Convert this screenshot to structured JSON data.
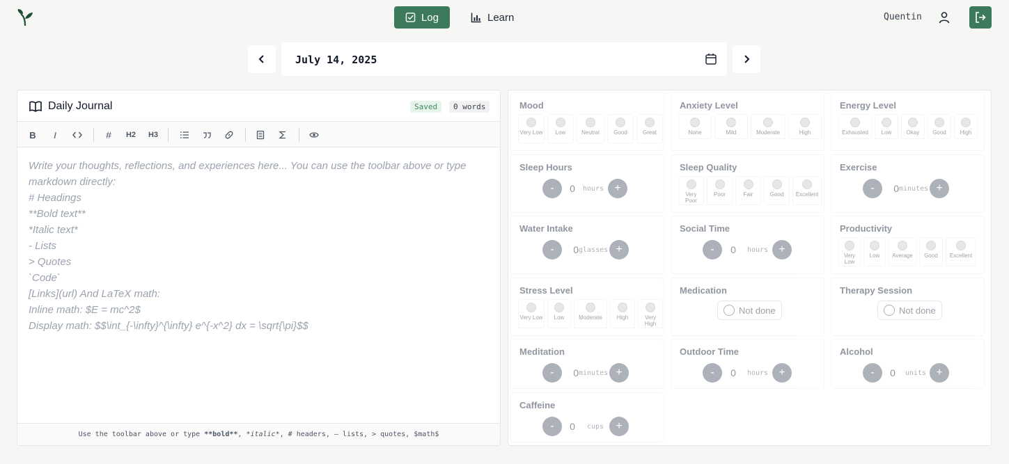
{
  "header": {
    "nav": [
      {
        "label": "Log",
        "active": true
      },
      {
        "label": "Learn",
        "active": false
      }
    ],
    "user": "Quentin",
    "accent": "#3d7a5c"
  },
  "date": {
    "label": "July 14, 2025"
  },
  "journal": {
    "title": "Daily Journal",
    "saved": "Saved",
    "words": "0 words",
    "toolbar": [
      "B",
      "I",
      "code",
      "#",
      "H2",
      "H3",
      "list",
      "quote",
      "link",
      "doc",
      "sigma",
      "preview"
    ],
    "placeholder": "Write your thoughts, reflections, and experiences here... You can use the toolbar above or type\nmarkdown directly:\n# Headings\n**Bold text**\n*Italic text*\n- Lists\n> Quotes\n`Code`\n[Links](url) And LaTeX math:\nInline math: $E = mc^2$\nDisplay math: $$\\int_{-\\infty}^{\\infty} e^{-x^2} dx = \\sqrt{\\pi}$$",
    "footer": {
      "a": "Use the toolbar above or type ",
      "b": "**bold**",
      ",": ", ",
      "c": "*italic*",
      "d": ", # headers, – lists, > quotes, $math$"
    }
  },
  "trackers": {
    "mood": {
      "title": "Mood",
      "options": [
        "Very Low",
        "Low",
        "Neutral",
        "Good",
        "Great"
      ]
    },
    "anxiety": {
      "title": "Anxiety Level",
      "options": [
        "None",
        "Mild",
        "Moderate",
        "High"
      ]
    },
    "energy": {
      "title": "Energy Level",
      "options": [
        "Exhausted",
        "Low",
        "Okay",
        "Good",
        "High"
      ]
    },
    "sleep_hours": {
      "title": "Sleep Hours",
      "value": "0",
      "unit": "hours"
    },
    "sleep_quality": {
      "title": "Sleep Quality",
      "options": [
        "Very Poor",
        "Poor",
        "Fair",
        "Good",
        "Excellent"
      ]
    },
    "exercise": {
      "title": "Exercise",
      "value": "0",
      "unit": "minutes"
    },
    "water": {
      "title": "Water Intake",
      "value": "0",
      "unit": "glasses"
    },
    "social": {
      "title": "Social Time",
      "value": "0",
      "unit": "hours"
    },
    "productivity": {
      "title": "Productivity",
      "options": [
        "Very Low",
        "Low",
        "Average",
        "Good",
        "Excellent"
      ]
    },
    "stress": {
      "title": "Stress Level",
      "options": [
        "Very Low",
        "Low",
        "Moderate",
        "High",
        "Very High"
      ]
    },
    "medication": {
      "title": "Medication",
      "state": "Not done"
    },
    "therapy": {
      "title": "Therapy Session",
      "state": "Not done"
    },
    "meditation": {
      "title": "Meditation",
      "value": "0",
      "unit": "minutes"
    },
    "outdoor": {
      "title": "Outdoor Time",
      "value": "0",
      "unit": "hours"
    },
    "alcohol": {
      "title": "Alcohol",
      "value": "0",
      "unit": "units"
    },
    "caffeine": {
      "title": "Caffeine",
      "value": "0",
      "unit": "cups"
    },
    "minus": "-",
    "plus": "+"
  }
}
